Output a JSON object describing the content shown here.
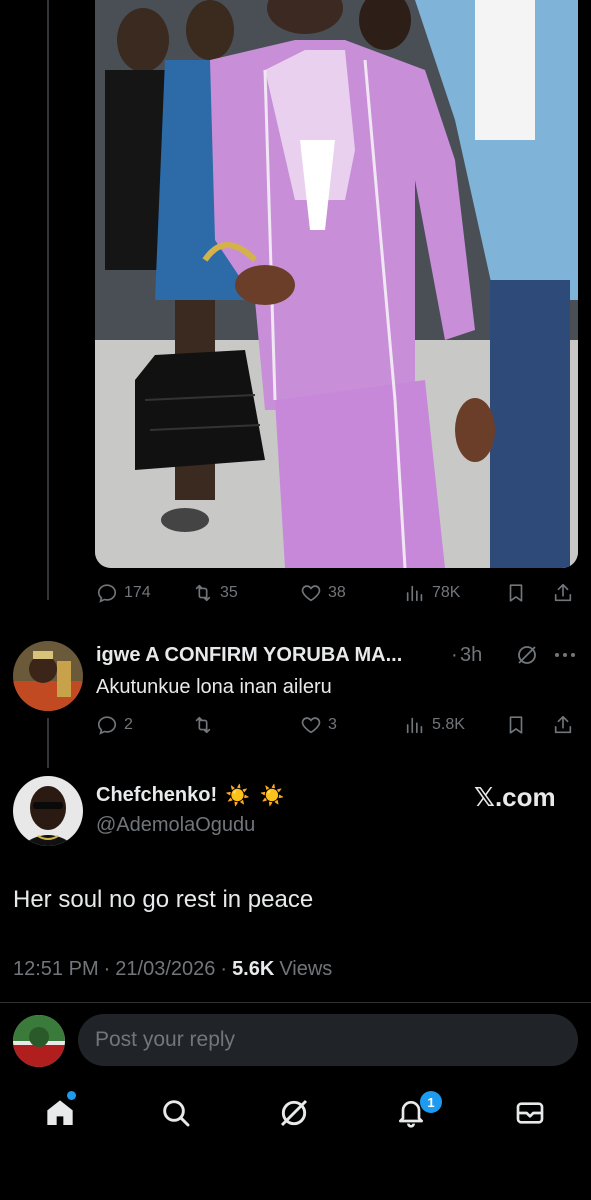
{
  "prev_tweet": {
    "image_alt": "",
    "stats": {
      "replies": "174",
      "retweets": "35",
      "likes": "38",
      "views": "78K"
    }
  },
  "reply": {
    "name": "igwe A CONFIRM YORUBA MA...",
    "separator": "·",
    "time": "3h",
    "text": "Akutunkue lona inan aileru",
    "stats": {
      "replies": "2",
      "retweets": "",
      "likes": "3",
      "views": "5.8K"
    }
  },
  "main_tweet": {
    "name": "Chefchenko!",
    "emoji": "☀️ ☀️",
    "handle": "@AdemolaOgudu",
    "watermark": "𝕏.com",
    "text": "Her soul no go rest in peace",
    "time": "12:51 PM",
    "dot1": "·",
    "date": "21/03/2026",
    "dot2": "·",
    "views_count": "5.6K",
    "views_label": "Views"
  },
  "compose": {
    "placeholder": "Post your reply"
  },
  "nav": {
    "notifications_badge": "1"
  },
  "colors": {
    "background": "#000000",
    "text": "#e7e9ea",
    "muted": "#71767b",
    "accent": "#1d9bf0",
    "input_bg": "#202327"
  }
}
